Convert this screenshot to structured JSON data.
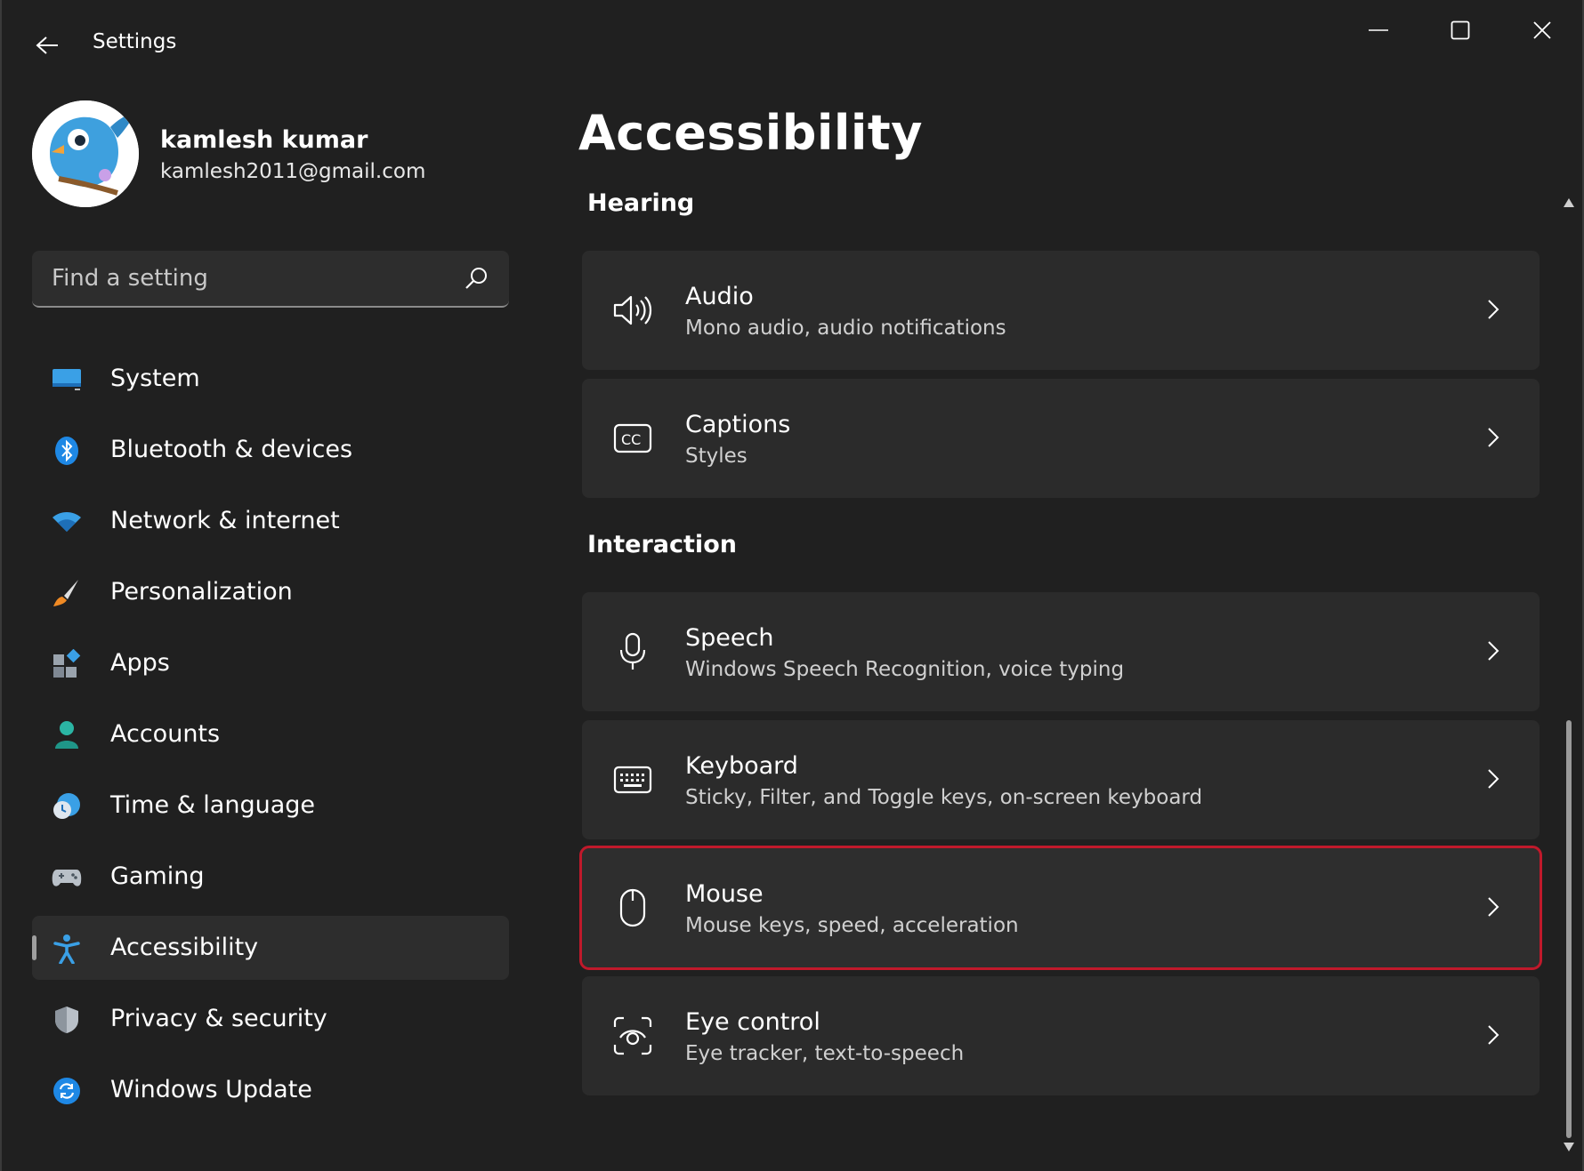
{
  "window": {
    "title": "Settings"
  },
  "profile": {
    "name": "kamlesh kumar",
    "email": "kamlesh2011@gmail.com"
  },
  "search": {
    "placeholder": "Find a setting"
  },
  "sidebar": {
    "items": [
      {
        "label": "System",
        "icon": "system-icon",
        "active": false
      },
      {
        "label": "Bluetooth & devices",
        "icon": "bluetooth-icon",
        "active": false
      },
      {
        "label": "Network & internet",
        "icon": "wifi-icon",
        "active": false
      },
      {
        "label": "Personalization",
        "icon": "brush-icon",
        "active": false
      },
      {
        "label": "Apps",
        "icon": "apps-icon",
        "active": false
      },
      {
        "label": "Accounts",
        "icon": "person-icon",
        "active": false
      },
      {
        "label": "Time & language",
        "icon": "clock-globe-icon",
        "active": false
      },
      {
        "label": "Gaming",
        "icon": "gamepad-icon",
        "active": false
      },
      {
        "label": "Accessibility",
        "icon": "accessibility-icon",
        "active": true
      },
      {
        "label": "Privacy & security",
        "icon": "shield-icon",
        "active": false
      },
      {
        "label": "Windows Update",
        "icon": "update-icon",
        "active": false
      }
    ]
  },
  "main": {
    "title": "Accessibility",
    "sections": [
      {
        "title": "Hearing",
        "cards": [
          {
            "title": "Audio",
            "subtitle": "Mono audio, audio notifications",
            "icon": "speaker-icon"
          },
          {
            "title": "Captions",
            "subtitle": "Styles",
            "icon": "captions-icon"
          }
        ]
      },
      {
        "title": "Interaction",
        "cards": [
          {
            "title": "Speech",
            "subtitle": "Windows Speech Recognition, voice typing",
            "icon": "microphone-icon"
          },
          {
            "title": "Keyboard",
            "subtitle": "Sticky, Filter, and Toggle keys, on-screen keyboard",
            "icon": "keyboard-icon"
          },
          {
            "title": "Mouse",
            "subtitle": "Mouse keys, speed, acceleration",
            "icon": "mouse-icon",
            "highlighted": true
          },
          {
            "title": "Eye control",
            "subtitle": "Eye tracker, text-to-speech",
            "icon": "eye-control-icon"
          }
        ]
      }
    ]
  },
  "colors": {
    "background": "#202020",
    "card": "#2b2b2b",
    "highlight_border": "#c0192b",
    "accent": "#0078d4"
  }
}
